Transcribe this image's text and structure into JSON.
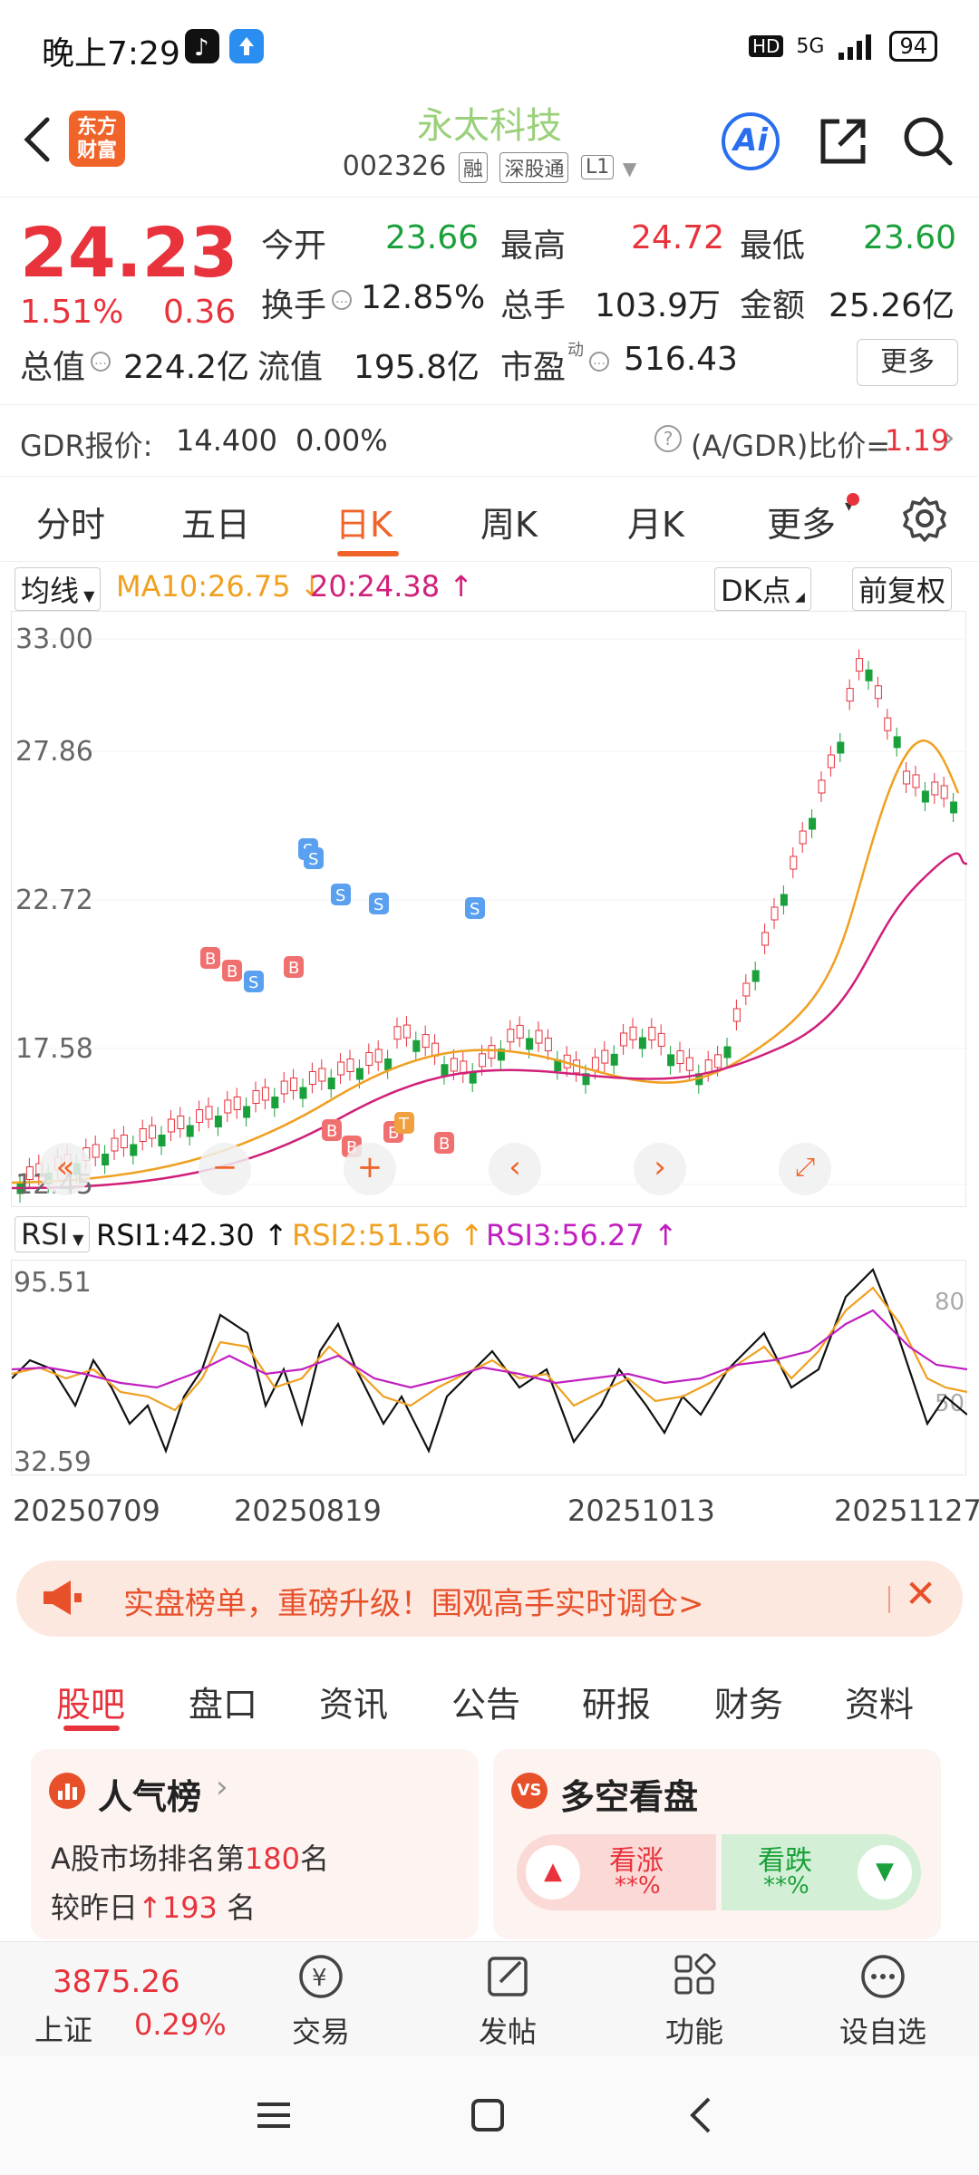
{
  "status_bar": {
    "time": "晚上7:29",
    "network": "5G",
    "battery": "94",
    "hd": "HD"
  },
  "header": {
    "back_icon": "chevron-left-icon",
    "logo_text": "东方财富",
    "title": "永太科技",
    "code": "002326",
    "tags": [
      "融",
      "深股通",
      "L1"
    ],
    "ai_label": "Ai"
  },
  "quote": {
    "price": "24.23",
    "change_pct": "1.51%",
    "change": "0.36",
    "open_label": "今开",
    "open": "23.66",
    "high_label": "最高",
    "high": "24.72",
    "low_label": "最低",
    "low": "23.60",
    "turnover_label": "换手",
    "turnover": "12.85%",
    "volume_label": "总手",
    "volume": "103.9万",
    "amount_label": "金额",
    "amount": "25.26亿",
    "mktcap_label": "总值",
    "mktcap": "224.2亿",
    "float_label": "流值",
    "float": "195.8亿",
    "pe_label": "市盈",
    "pe_sup": "动",
    "pe": "516.43",
    "more_label": "更多"
  },
  "gdr": {
    "label": "GDR报价:",
    "price": "14.400",
    "pct": "0.00%",
    "ratio_label": "(A/GDR)比价=",
    "ratio": "1.19"
  },
  "period_tabs": [
    "分时",
    "五日",
    "日K",
    "周K",
    "月K",
    "更多"
  ],
  "active_tab": "日K",
  "ma": {
    "selector": "均线",
    "ma10": "MA10:26.75",
    "ma20": "20:24.38",
    "dk_label": "DK点",
    "adjust_label": "前复权"
  },
  "colors": {
    "up": "#e8323c",
    "down": "#1aa03a",
    "accent": "#f0642a",
    "ma10": "#f0a020",
    "ma20": "#d0207a"
  },
  "kline_axis": {
    "y_ticks": [
      "33.00",
      "27.86",
      "22.72",
      "17.58",
      "12.45"
    ]
  },
  "rsi": {
    "selector": "RSI",
    "rsi1": "RSI1:42.30",
    "rsi2": "RSI2:51.56",
    "rsi3": "RSI3:56.27",
    "y_top": "95.51",
    "y_bottom": "32.59",
    "level_80": "80",
    "level_50": "50"
  },
  "x_axis_dates": [
    "20250709",
    "20250819",
    "20251013",
    "20251127"
  ],
  "ad_banner": {
    "text": "实盘榜单，重磅升级！围观高手实时调仓>"
  },
  "feature_tabs": [
    "股吧",
    "盘口",
    "资讯",
    "公告",
    "研报",
    "财务",
    "资料"
  ],
  "active_feature_tab": "股吧",
  "popularity": {
    "title": "人气榜",
    "rank_prefix": "A股市场排名第",
    "rank": "180",
    "rank_suffix": "名",
    "change_prefix": "较昨日",
    "change": "193",
    "change_suffix": " 名"
  },
  "sentiment": {
    "title": "多空看盘",
    "up_label": "看涨",
    "up_pct": "**%",
    "down_label": "看跌",
    "down_pct": "**%"
  },
  "bottom_nav": {
    "index_value": "3875.26",
    "index_name": "上证",
    "index_pct": "0.29%",
    "items": [
      "交易",
      "发帖",
      "功能",
      "设自选"
    ]
  }
}
